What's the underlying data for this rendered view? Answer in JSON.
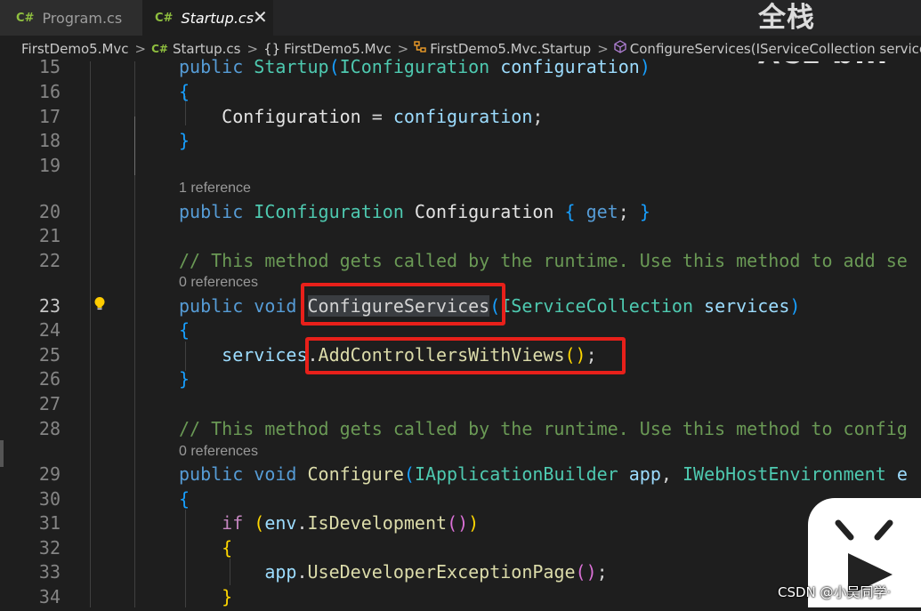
{
  "tabs": [
    {
      "icon": "C#",
      "label": "Program.cs"
    },
    {
      "icon": "C#",
      "label": "Startup.cs",
      "close": "✕"
    }
  ],
  "watermark": {
    "text": "全栈ACE",
    "logo_text": "bili"
  },
  "breadcrumb": [
    "FirstDemo5.Mvc",
    "Startup.cs",
    "FirstDemo5.Mvc",
    "FirstDemo5.Mvc.Startup",
    "ConfigureServices(IServiceCollection services)"
  ],
  "breadcrumb_icons": {
    "file": "C#",
    "namespace": "{}"
  },
  "lens": [
    "1 reference",
    "0 references",
    "0 references"
  ],
  "colors": {
    "keyword": "#569cd6",
    "control": "#c586c0",
    "type": "#4ec9b0",
    "parameter": "#9cdcfe",
    "method": "#dcdcaa",
    "comment": "#6a9955",
    "bracket1": "#ffd700",
    "bracket2": "#da70d6",
    "bracket3": "#179fff",
    "highlight_box": "#e8201a"
  },
  "lines": [
    {
      "n": "15",
      "tokens": [
        [
          "kw",
          "public "
        ],
        [
          "type",
          "Startup"
        ],
        [
          "p3",
          "("
        ],
        [
          "type",
          "IConfiguration "
        ],
        [
          "param",
          "configuration"
        ],
        [
          "p3",
          ")"
        ]
      ]
    },
    {
      "n": "16",
      "tokens": [
        [
          "p3",
          "{"
        ]
      ]
    },
    {
      "n": "17",
      "tokens": [
        [
          "plain",
          "    "
        ],
        [
          "prop",
          "Configuration"
        ],
        [
          "plain",
          " = "
        ],
        [
          "param",
          "configuration"
        ],
        [
          "plain",
          ";"
        ]
      ]
    },
    {
      "n": "18",
      "tokens": [
        [
          "p3",
          "}"
        ]
      ]
    },
    {
      "n": "19",
      "tokens": []
    },
    {
      "n": "20",
      "tokens": [
        [
          "kw",
          "public "
        ],
        [
          "type",
          "IConfiguration "
        ],
        [
          "prop",
          "Configuration "
        ],
        [
          "p3",
          "{ "
        ],
        [
          "kw",
          "get"
        ],
        [
          "plain",
          "; "
        ],
        [
          "p3",
          "}"
        ]
      ]
    },
    {
      "n": "21",
      "tokens": []
    },
    {
      "n": "22",
      "tokens": [
        [
          "com",
          "// This method gets called by the runtime. Use this method to add se"
        ]
      ]
    },
    {
      "n": "23",
      "active": true,
      "tokens": [
        [
          "kw",
          "public "
        ],
        [
          "kw",
          "void "
        ],
        [
          "sel",
          "ConfigureServices"
        ],
        [
          "p3",
          "("
        ],
        [
          "type",
          "IServiceCollection "
        ],
        [
          "param",
          "services"
        ],
        [
          "p3",
          ")"
        ]
      ]
    },
    {
      "n": "24",
      "tokens": [
        [
          "p3",
          "{"
        ]
      ]
    },
    {
      "n": "25",
      "tokens": [
        [
          "plain",
          "    "
        ],
        [
          "param",
          "services"
        ],
        [
          "plain",
          "."
        ],
        [
          "meth",
          "AddControllersWithViews"
        ],
        [
          "p1",
          "()"
        ],
        [
          "plain",
          ";"
        ]
      ]
    },
    {
      "n": "26",
      "tokens": [
        [
          "p3",
          "}"
        ]
      ]
    },
    {
      "n": "27",
      "tokens": []
    },
    {
      "n": "28",
      "tokens": [
        [
          "com",
          "// This method gets called by the runtime. Use this method to config"
        ]
      ]
    },
    {
      "n": "29",
      "tokens": [
        [
          "kw",
          "public "
        ],
        [
          "kw",
          "void "
        ],
        [
          "meth",
          "Configure"
        ],
        [
          "p3",
          "("
        ],
        [
          "type",
          "IApplicationBuilder "
        ],
        [
          "param",
          "app"
        ],
        [
          "plain",
          ", "
        ],
        [
          "type",
          "IWebHostEnvironment "
        ],
        [
          "param",
          "e"
        ]
      ]
    },
    {
      "n": "30",
      "tokens": [
        [
          "p3",
          "{"
        ]
      ]
    },
    {
      "n": "31",
      "tokens": [
        [
          "plain",
          "    "
        ],
        [
          "ctrl",
          "if "
        ],
        [
          "p1",
          "("
        ],
        [
          "param",
          "env"
        ],
        [
          "plain",
          "."
        ],
        [
          "meth",
          "IsDevelopment"
        ],
        [
          "p2",
          "()"
        ],
        [
          "p1",
          ")"
        ]
      ]
    },
    {
      "n": "32",
      "tokens": [
        [
          "plain",
          "    "
        ],
        [
          "p1",
          "{"
        ]
      ]
    },
    {
      "n": "33",
      "tokens": [
        [
          "plain",
          "        "
        ],
        [
          "param",
          "app"
        ],
        [
          "plain",
          "."
        ],
        [
          "meth",
          "UseDeveloperExceptionPage"
        ],
        [
          "p2",
          "()"
        ],
        [
          "plain",
          ";"
        ]
      ]
    },
    {
      "n": "34",
      "tokens": [
        [
          "plain",
          "    "
        ],
        [
          "p1",
          "}"
        ]
      ]
    }
  ],
  "csdn_watermark": "CSDN @小吴同学·"
}
